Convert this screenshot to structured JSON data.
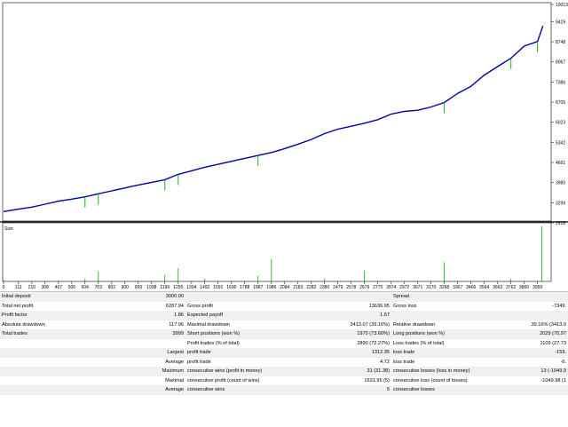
{
  "chart_data": {
    "type": "line",
    "title": "",
    "series": [
      {
        "name": "",
        "color": "#0000aa",
        "x": [
          0,
          111,
          210,
          308,
          407,
          506,
          604,
          703,
          802,
          900,
          999,
          1098,
          1196,
          1295,
          1394,
          1492,
          1591,
          1690,
          1788,
          1887,
          1986,
          2084,
          2183,
          2282,
          2380,
          2479,
          2578,
          2676,
          2775,
          2874,
          2972,
          3071,
          3170,
          3268,
          3367,
          3466,
          3564,
          3663,
          3762,
          3860,
          3959,
          3999
        ],
        "y": [
          3000,
          3080,
          3150,
          3250,
          3350,
          3420,
          3500,
          3600,
          3700,
          3800,
          3900,
          3990,
          4080,
          4260,
          4380,
          4500,
          4600,
          4700,
          4800,
          4900,
          5000,
          5130,
          5280,
          5440,
          5640,
          5790,
          5890,
          5990,
          6110,
          6300,
          6390,
          6430,
          6540,
          6690,
          7000,
          7240,
          7620,
          7910,
          8190,
          8600,
          8760,
          9287
        ]
      }
    ],
    "y_ticks": [
      "10013",
      "9429",
      "8748",
      "8067",
      "7386",
      "6705",
      "6023",
      "5342",
      "4661",
      "3980",
      "3299",
      "2618"
    ],
    "ylim": [
      2618,
      10013
    ],
    "x_ticks": [
      "0",
      "111",
      "210",
      "308",
      "407",
      "506",
      "604",
      "703",
      "802",
      "900",
      "999",
      "1098",
      "1196",
      "1295",
      "1394",
      "1492",
      "1591",
      "1690",
      "1788",
      "1887",
      "1986",
      "2084",
      "2183",
      "2282",
      "2380",
      "2479",
      "2578",
      "2676",
      "2775",
      "2874",
      "2972",
      "3071",
      "3170",
      "3268",
      "3367",
      "3466",
      "3564",
      "3663",
      "3762",
      "3860",
      "3959"
    ],
    "xlim": [
      0,
      4060
    ],
    "size_panel": {
      "label": "Size",
      "bar_color": "#00aa00",
      "bars": [
        {
          "x": 0,
          "v": 0.02
        },
        {
          "x": 604,
          "v": 0.05
        },
        {
          "x": 703,
          "v": 0.18
        },
        {
          "x": 1196,
          "v": 0.12
        },
        {
          "x": 1295,
          "v": 0.24
        },
        {
          "x": 1492,
          "v": 0.05
        },
        {
          "x": 1887,
          "v": 0.1
        },
        {
          "x": 1986,
          "v": 0.4
        },
        {
          "x": 2380,
          "v": 0.05
        },
        {
          "x": 2676,
          "v": 0.2
        },
        {
          "x": 3268,
          "v": 0.35
        },
        {
          "x": 3762,
          "v": 0.05
        },
        {
          "x": 3990,
          "v": 1.0
        }
      ]
    }
  },
  "report": {
    "rows": [
      [
        "Initial deposit",
        "3000.00",
        "",
        "",
        "Spread",
        ""
      ],
      [
        "Total net profit",
        "6287.94",
        "Gross profit",
        "13636.95",
        "Gross loss",
        "-7349."
      ],
      [
        "Profit factor",
        "1.86",
        "Expected payoff",
        "1.57",
        "",
        ""
      ],
      [
        "Absolute drawdown",
        "117.96",
        "Maximal drawdown",
        "3413.07 (39.16%)",
        "Relative drawdown",
        "39.16% (3413.0"
      ],
      [
        "Total trades",
        "3999",
        "Short positions (won %)",
        "1970 (73.60%)",
        "Long positions (won %)",
        "2029 (70.97"
      ],
      [
        "",
        "",
        "Profit trades (% of total)",
        "2890 (72.27%)",
        "Loss trades (% of total)",
        "1109 (27.73"
      ],
      [
        "",
        "Largest",
        "profit trade",
        "1312.35",
        "loss trade",
        "-159."
      ],
      [
        "",
        "Average",
        "profit trade",
        "4.72",
        "loss trade",
        "-6."
      ],
      [
        "",
        "Maximum",
        "consecutive wins (profit in money)",
        "31 (31.38)",
        "consecutive losses (loss in money)",
        "13 (-1049.9"
      ],
      [
        "",
        "Maximal",
        "consecutive profit (count of wins)",
        "1631.95 (5)",
        "consecutive loss (count of losses)",
        "-1049.98 (1"
      ],
      [
        "",
        "Average",
        "consecutive wins",
        "5",
        "consecutive losses",
        ""
      ]
    ]
  }
}
